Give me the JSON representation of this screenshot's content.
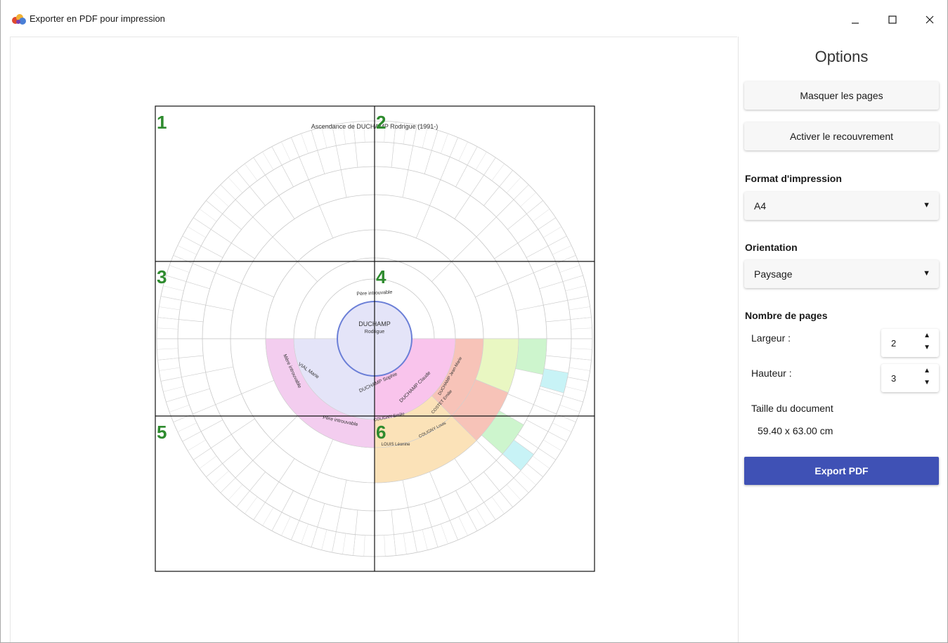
{
  "window": {
    "title": "Exporter en PDF pour impression",
    "icon": "app-logo-icon",
    "controls": {
      "minimize": "minimize-icon",
      "maximize": "maximize-icon",
      "close": "close-icon"
    }
  },
  "preview": {
    "chart_title": "Ascendance de DUCHAMP Rodrigue (1991-)",
    "page_numbers": [
      "1",
      "2",
      "3",
      "4",
      "5",
      "6"
    ],
    "center_name": "DUCHAMP",
    "center_firstname": "Rodrigue",
    "father_unknown": "Père introuvable",
    "mother_unknown": "Mère introuvable",
    "paternal_gp_unknown": "Père introuvable",
    "mother_name": "DUCHAMP Sophie",
    "grandmother_name": "DUCHAMP Claude",
    "ggparent_1": "DUCHAMP Jean-Marie",
    "ggparent_2": "COSTET Emilie",
    "side_name": "VIAL Marie",
    "coligny_1": "COLIGNY Emilie",
    "coligny_2": "COLIGNY Louis",
    "louis_name": "LOUIS Léonine",
    "colors": {
      "grid": "#111111",
      "page_number": "#2e8b2e",
      "ring": "#c8c8c8",
      "center_fill": "#e4e4f8",
      "center_stroke": "#6b7fd7",
      "pink": "#f9c4ec",
      "salmon": "#f7c3b8",
      "orange": "#fbe2b8",
      "lime": "#e9f7c2",
      "green": "#cdf5cd",
      "cyan": "#c8f3f6",
      "export": "#3f51b5"
    }
  },
  "options": {
    "title": "Options",
    "hide_pages_label": "Masquer les pages",
    "overlap_label": "Activer le recouvrement",
    "format_label": "Format d'impression",
    "format_value": "A4",
    "orientation_label": "Orientation",
    "orientation_value": "Paysage",
    "pages_label": "Nombre de pages",
    "width_label": "Largeur :",
    "width_value": "2",
    "height_label": "Hauteur :",
    "height_value": "3",
    "docsize_label": "Taille du document",
    "docsize_value": "59.40 x 63.00 cm",
    "export_label": "Export PDF"
  }
}
